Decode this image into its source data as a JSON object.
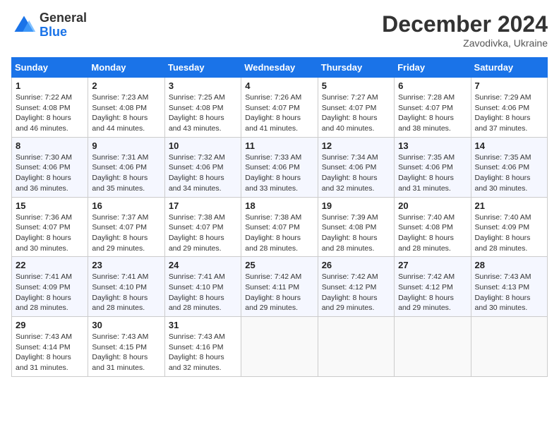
{
  "header": {
    "logo_line1": "General",
    "logo_line2": "Blue",
    "month": "December 2024",
    "location": "Zavodivka, Ukraine"
  },
  "days_of_week": [
    "Sunday",
    "Monday",
    "Tuesday",
    "Wednesday",
    "Thursday",
    "Friday",
    "Saturday"
  ],
  "weeks": [
    [
      {
        "day": "1",
        "sunrise": "7:22 AM",
        "sunset": "4:08 PM",
        "daylight": "8 hours and 46 minutes."
      },
      {
        "day": "2",
        "sunrise": "7:23 AM",
        "sunset": "4:08 PM",
        "daylight": "8 hours and 44 minutes."
      },
      {
        "day": "3",
        "sunrise": "7:25 AM",
        "sunset": "4:08 PM",
        "daylight": "8 hours and 43 minutes."
      },
      {
        "day": "4",
        "sunrise": "7:26 AM",
        "sunset": "4:07 PM",
        "daylight": "8 hours and 41 minutes."
      },
      {
        "day": "5",
        "sunrise": "7:27 AM",
        "sunset": "4:07 PM",
        "daylight": "8 hours and 40 minutes."
      },
      {
        "day": "6",
        "sunrise": "7:28 AM",
        "sunset": "4:07 PM",
        "daylight": "8 hours and 38 minutes."
      },
      {
        "day": "7",
        "sunrise": "7:29 AM",
        "sunset": "4:06 PM",
        "daylight": "8 hours and 37 minutes."
      }
    ],
    [
      {
        "day": "8",
        "sunrise": "7:30 AM",
        "sunset": "4:06 PM",
        "daylight": "8 hours and 36 minutes."
      },
      {
        "day": "9",
        "sunrise": "7:31 AM",
        "sunset": "4:06 PM",
        "daylight": "8 hours and 35 minutes."
      },
      {
        "day": "10",
        "sunrise": "7:32 AM",
        "sunset": "4:06 PM",
        "daylight": "8 hours and 34 minutes."
      },
      {
        "day": "11",
        "sunrise": "7:33 AM",
        "sunset": "4:06 PM",
        "daylight": "8 hours and 33 minutes."
      },
      {
        "day": "12",
        "sunrise": "7:34 AM",
        "sunset": "4:06 PM",
        "daylight": "8 hours and 32 minutes."
      },
      {
        "day": "13",
        "sunrise": "7:35 AM",
        "sunset": "4:06 PM",
        "daylight": "8 hours and 31 minutes."
      },
      {
        "day": "14",
        "sunrise": "7:35 AM",
        "sunset": "4:06 PM",
        "daylight": "8 hours and 30 minutes."
      }
    ],
    [
      {
        "day": "15",
        "sunrise": "7:36 AM",
        "sunset": "4:07 PM",
        "daylight": "8 hours and 30 minutes."
      },
      {
        "day": "16",
        "sunrise": "7:37 AM",
        "sunset": "4:07 PM",
        "daylight": "8 hours and 29 minutes."
      },
      {
        "day": "17",
        "sunrise": "7:38 AM",
        "sunset": "4:07 PM",
        "daylight": "8 hours and 29 minutes."
      },
      {
        "day": "18",
        "sunrise": "7:38 AM",
        "sunset": "4:07 PM",
        "daylight": "8 hours and 28 minutes."
      },
      {
        "day": "19",
        "sunrise": "7:39 AM",
        "sunset": "4:08 PM",
        "daylight": "8 hours and 28 minutes."
      },
      {
        "day": "20",
        "sunrise": "7:40 AM",
        "sunset": "4:08 PM",
        "daylight": "8 hours and 28 minutes."
      },
      {
        "day": "21",
        "sunrise": "7:40 AM",
        "sunset": "4:09 PM",
        "daylight": "8 hours and 28 minutes."
      }
    ],
    [
      {
        "day": "22",
        "sunrise": "7:41 AM",
        "sunset": "4:09 PM",
        "daylight": "8 hours and 28 minutes."
      },
      {
        "day": "23",
        "sunrise": "7:41 AM",
        "sunset": "4:10 PM",
        "daylight": "8 hours and 28 minutes."
      },
      {
        "day": "24",
        "sunrise": "7:41 AM",
        "sunset": "4:10 PM",
        "daylight": "8 hours and 28 minutes."
      },
      {
        "day": "25",
        "sunrise": "7:42 AM",
        "sunset": "4:11 PM",
        "daylight": "8 hours and 29 minutes."
      },
      {
        "day": "26",
        "sunrise": "7:42 AM",
        "sunset": "4:12 PM",
        "daylight": "8 hours and 29 minutes."
      },
      {
        "day": "27",
        "sunrise": "7:42 AM",
        "sunset": "4:12 PM",
        "daylight": "8 hours and 29 minutes."
      },
      {
        "day": "28",
        "sunrise": "7:43 AM",
        "sunset": "4:13 PM",
        "daylight": "8 hours and 30 minutes."
      }
    ],
    [
      {
        "day": "29",
        "sunrise": "7:43 AM",
        "sunset": "4:14 PM",
        "daylight": "8 hours and 31 minutes."
      },
      {
        "day": "30",
        "sunrise": "7:43 AM",
        "sunset": "4:15 PM",
        "daylight": "8 hours and 31 minutes."
      },
      {
        "day": "31",
        "sunrise": "7:43 AM",
        "sunset": "4:16 PM",
        "daylight": "8 hours and 32 minutes."
      },
      null,
      null,
      null,
      null
    ]
  ]
}
